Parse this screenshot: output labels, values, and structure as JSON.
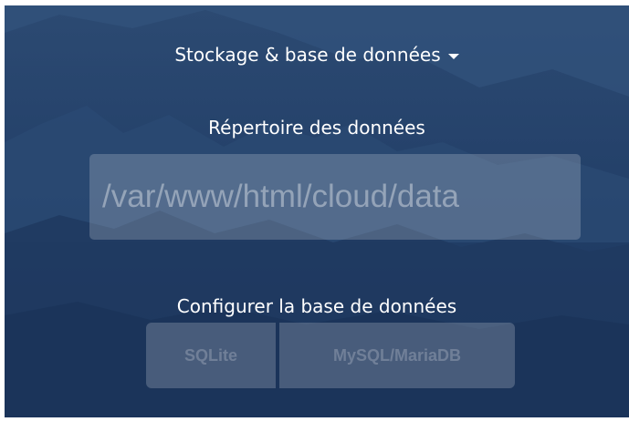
{
  "storage_section": {
    "title": "Stockage & base de données",
    "expanded": true
  },
  "data_directory": {
    "label": "Répertoire des données",
    "placeholder": "/var/www/html/cloud/data",
    "value": ""
  },
  "database": {
    "label": "Configurer la base de données",
    "options": [
      {
        "label": "SQLite"
      },
      {
        "label": "MySQL/MariaDB"
      }
    ]
  },
  "colors": {
    "background": "#24416a",
    "text": "#ffffff"
  }
}
